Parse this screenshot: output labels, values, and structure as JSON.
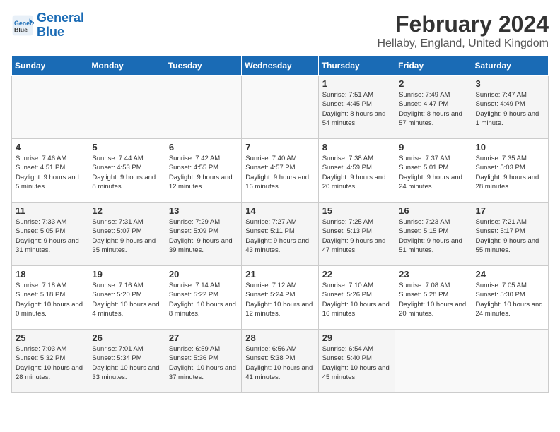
{
  "logo": {
    "line1": "General",
    "line2": "Blue"
  },
  "title": "February 2024",
  "subtitle": "Hellaby, England, United Kingdom",
  "days_of_week": [
    "Sunday",
    "Monday",
    "Tuesday",
    "Wednesday",
    "Thursday",
    "Friday",
    "Saturday"
  ],
  "weeks": [
    [
      {
        "day": "",
        "info": ""
      },
      {
        "day": "",
        "info": ""
      },
      {
        "day": "",
        "info": ""
      },
      {
        "day": "",
        "info": ""
      },
      {
        "day": "1",
        "info": "Sunrise: 7:51 AM\nSunset: 4:45 PM\nDaylight: 8 hours\nand 54 minutes."
      },
      {
        "day": "2",
        "info": "Sunrise: 7:49 AM\nSunset: 4:47 PM\nDaylight: 8 hours\nand 57 minutes."
      },
      {
        "day": "3",
        "info": "Sunrise: 7:47 AM\nSunset: 4:49 PM\nDaylight: 9 hours\nand 1 minute."
      }
    ],
    [
      {
        "day": "4",
        "info": "Sunrise: 7:46 AM\nSunset: 4:51 PM\nDaylight: 9 hours\nand 5 minutes."
      },
      {
        "day": "5",
        "info": "Sunrise: 7:44 AM\nSunset: 4:53 PM\nDaylight: 9 hours\nand 8 minutes."
      },
      {
        "day": "6",
        "info": "Sunrise: 7:42 AM\nSunset: 4:55 PM\nDaylight: 9 hours\nand 12 minutes."
      },
      {
        "day": "7",
        "info": "Sunrise: 7:40 AM\nSunset: 4:57 PM\nDaylight: 9 hours\nand 16 minutes."
      },
      {
        "day": "8",
        "info": "Sunrise: 7:38 AM\nSunset: 4:59 PM\nDaylight: 9 hours\nand 20 minutes."
      },
      {
        "day": "9",
        "info": "Sunrise: 7:37 AM\nSunset: 5:01 PM\nDaylight: 9 hours\nand 24 minutes."
      },
      {
        "day": "10",
        "info": "Sunrise: 7:35 AM\nSunset: 5:03 PM\nDaylight: 9 hours\nand 28 minutes."
      }
    ],
    [
      {
        "day": "11",
        "info": "Sunrise: 7:33 AM\nSunset: 5:05 PM\nDaylight: 9 hours\nand 31 minutes."
      },
      {
        "day": "12",
        "info": "Sunrise: 7:31 AM\nSunset: 5:07 PM\nDaylight: 9 hours\nand 35 minutes."
      },
      {
        "day": "13",
        "info": "Sunrise: 7:29 AM\nSunset: 5:09 PM\nDaylight: 9 hours\nand 39 minutes."
      },
      {
        "day": "14",
        "info": "Sunrise: 7:27 AM\nSunset: 5:11 PM\nDaylight: 9 hours\nand 43 minutes."
      },
      {
        "day": "15",
        "info": "Sunrise: 7:25 AM\nSunset: 5:13 PM\nDaylight: 9 hours\nand 47 minutes."
      },
      {
        "day": "16",
        "info": "Sunrise: 7:23 AM\nSunset: 5:15 PM\nDaylight: 9 hours\nand 51 minutes."
      },
      {
        "day": "17",
        "info": "Sunrise: 7:21 AM\nSunset: 5:17 PM\nDaylight: 9 hours\nand 55 minutes."
      }
    ],
    [
      {
        "day": "18",
        "info": "Sunrise: 7:18 AM\nSunset: 5:18 PM\nDaylight: 10 hours\nand 0 minutes."
      },
      {
        "day": "19",
        "info": "Sunrise: 7:16 AM\nSunset: 5:20 PM\nDaylight: 10 hours\nand 4 minutes."
      },
      {
        "day": "20",
        "info": "Sunrise: 7:14 AM\nSunset: 5:22 PM\nDaylight: 10 hours\nand 8 minutes."
      },
      {
        "day": "21",
        "info": "Sunrise: 7:12 AM\nSunset: 5:24 PM\nDaylight: 10 hours\nand 12 minutes."
      },
      {
        "day": "22",
        "info": "Sunrise: 7:10 AM\nSunset: 5:26 PM\nDaylight: 10 hours\nand 16 minutes."
      },
      {
        "day": "23",
        "info": "Sunrise: 7:08 AM\nSunset: 5:28 PM\nDaylight: 10 hours\nand 20 minutes."
      },
      {
        "day": "24",
        "info": "Sunrise: 7:05 AM\nSunset: 5:30 PM\nDaylight: 10 hours\nand 24 minutes."
      }
    ],
    [
      {
        "day": "25",
        "info": "Sunrise: 7:03 AM\nSunset: 5:32 PM\nDaylight: 10 hours\nand 28 minutes."
      },
      {
        "day": "26",
        "info": "Sunrise: 7:01 AM\nSunset: 5:34 PM\nDaylight: 10 hours\nand 33 minutes."
      },
      {
        "day": "27",
        "info": "Sunrise: 6:59 AM\nSunset: 5:36 PM\nDaylight: 10 hours\nand 37 minutes."
      },
      {
        "day": "28",
        "info": "Sunrise: 6:56 AM\nSunset: 5:38 PM\nDaylight: 10 hours\nand 41 minutes."
      },
      {
        "day": "29",
        "info": "Sunrise: 6:54 AM\nSunset: 5:40 PM\nDaylight: 10 hours\nand 45 minutes."
      },
      {
        "day": "",
        "info": ""
      },
      {
        "day": "",
        "info": ""
      }
    ]
  ]
}
